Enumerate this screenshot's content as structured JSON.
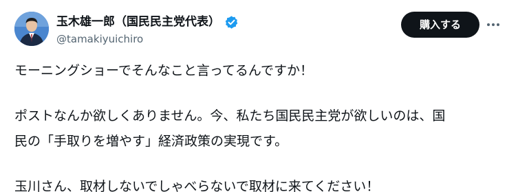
{
  "author": {
    "display_name": "玉木雄一郎（国民民主党代表）",
    "handle": "@tamakiyuichiro",
    "verified_icon": "verified-badge-icon",
    "verified_color": "#1d9bf0"
  },
  "header": {
    "subscribe_label": "購入する",
    "more_icon": "more-horizontal-icon"
  },
  "tweet": {
    "line1": "モーニングショーでそんなこと言ってるんですか！",
    "line2": "ポストなんか欲しくありません。今、私たち国民民主党が欲しいのは、国",
    "line3": "民の「手取りを増やす」経済政策の実現です。",
    "line4": "玉川さん、取材しないでしゃべらないで取材に来てください！"
  }
}
